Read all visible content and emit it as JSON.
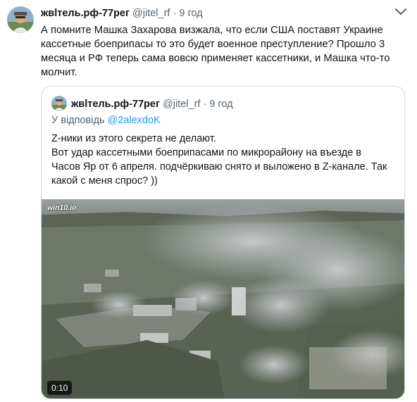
{
  "tweet": {
    "author_name": "жвlтель.рф-77рег",
    "handle": "@jitel_rf",
    "separator": "·",
    "time": "9 год",
    "text": "А помните Машка Захарова визжала, что если США поставят Украине кассетные боеприпасы то это будет военное преступление? Прошло 3 месяца и РФ теперь сама вовсю применяет кассетники, и Машка что-то молчит."
  },
  "quoted_tweet": {
    "author_name": "жвlтель.рф-77рег",
    "handle": "@jitel_rf",
    "separator": "·",
    "time": "9 год",
    "reply_prefix": "У відповідь",
    "reply_mention": "@2alexdoK",
    "text_lines": [
      "Z-ники из этого секрета не делают.",
      "Вот удар кассетными боеприпасами по микрорайону на въезде в",
      "Часов Яр от 6 апреля. подчёркиваю снято и выложено в Z-канале. Так",
      "какой с меня спрос? ))"
    ],
    "video": {
      "watermark": "win10.io",
      "duration": "0:10"
    }
  },
  "icons": {
    "more": "more-options-icon",
    "play": "video-thumbnail"
  }
}
